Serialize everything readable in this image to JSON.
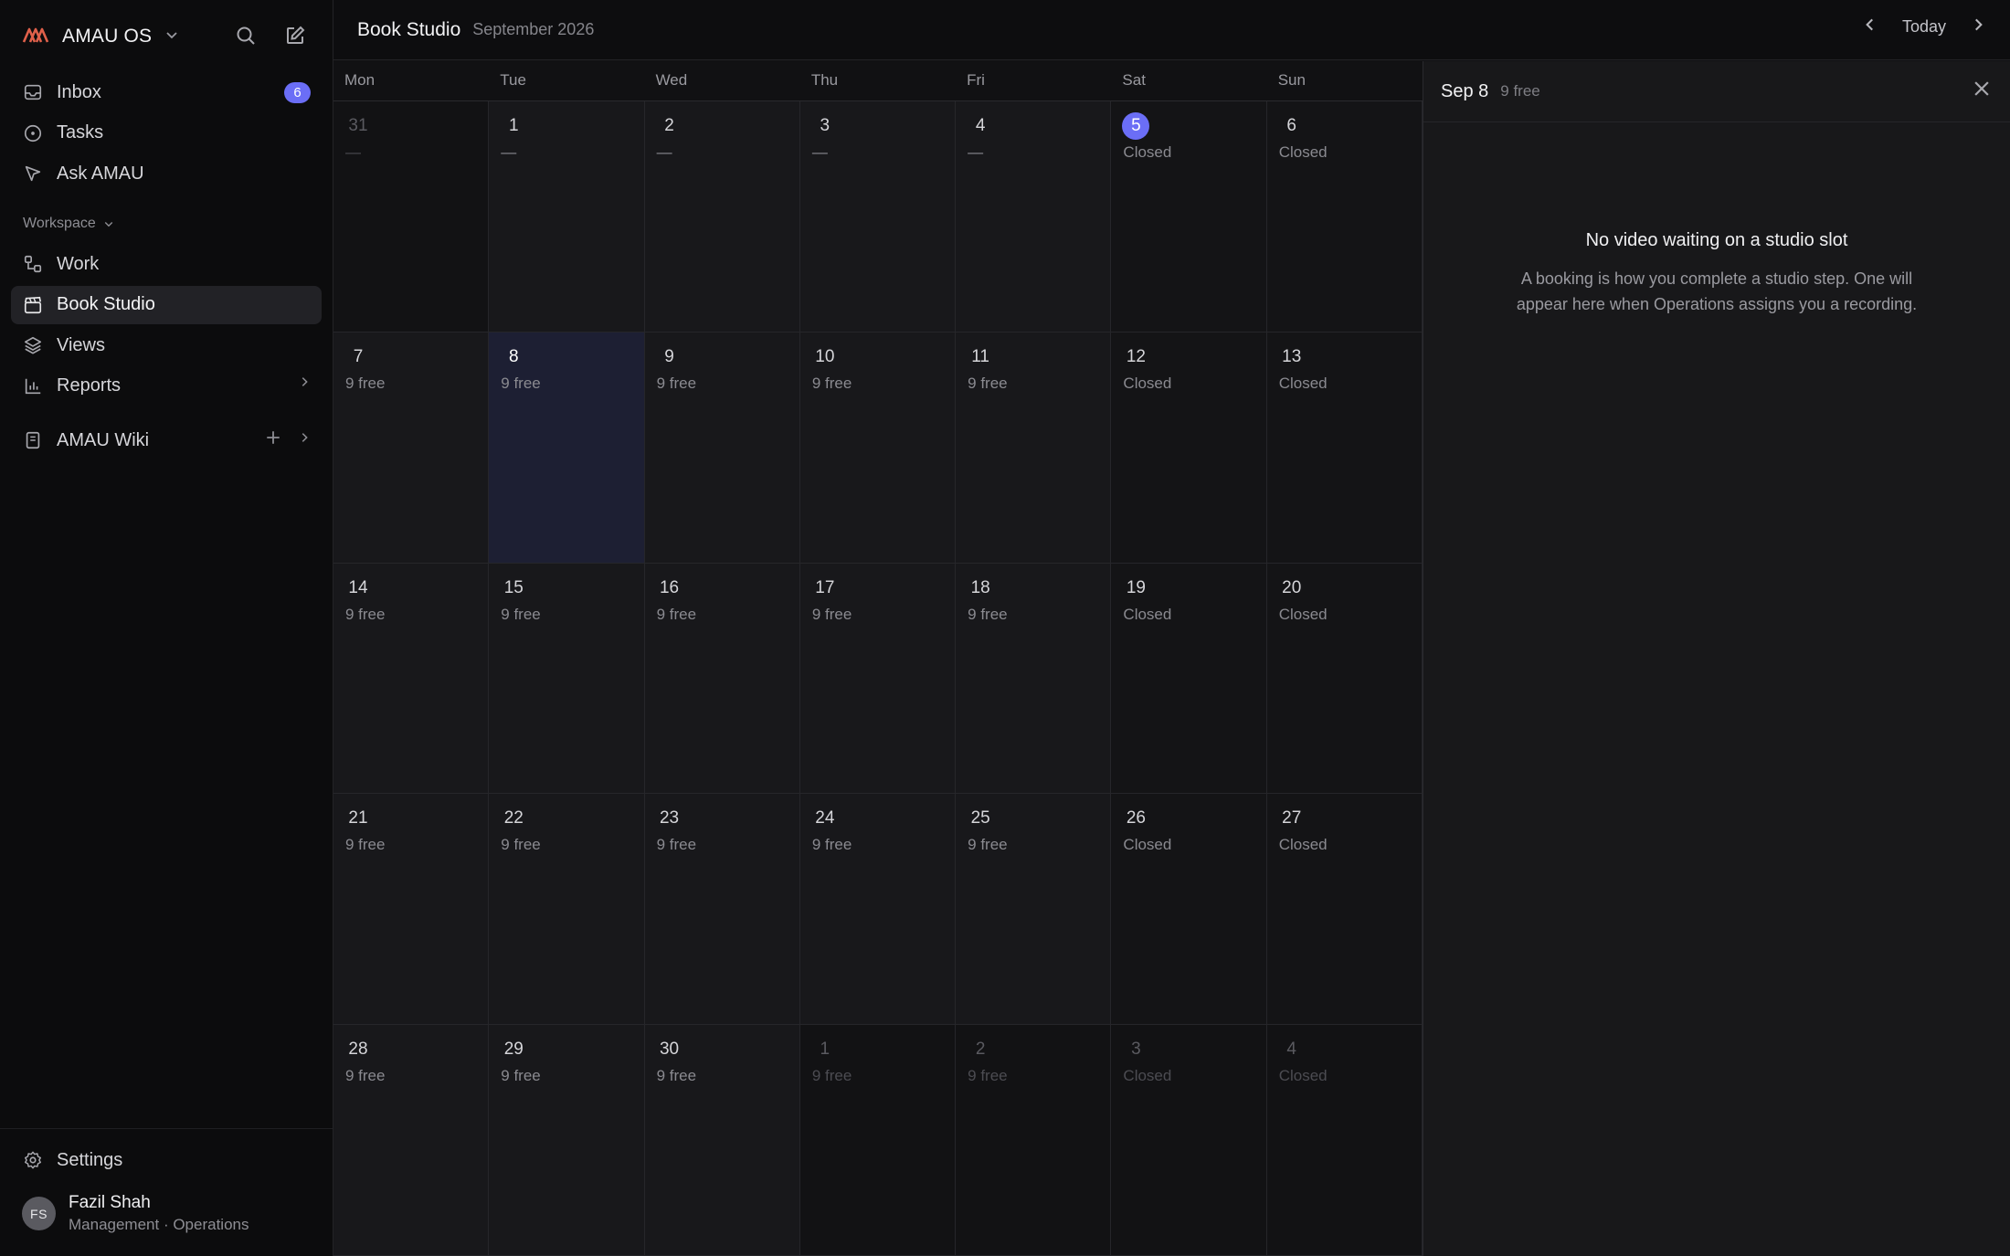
{
  "sidebar": {
    "brand": "AMAU OS",
    "primary": [
      {
        "label": "Inbox",
        "icon": "inbox-icon",
        "badge": "6"
      },
      {
        "label": "Tasks",
        "icon": "circle-dot-icon"
      },
      {
        "label": "Ask AMAU",
        "icon": "cursor-icon"
      }
    ],
    "workspace_label": "Workspace",
    "workspace": [
      {
        "label": "Work",
        "icon": "workflow-icon"
      },
      {
        "label": "Book Studio",
        "icon": "clapperboard-icon",
        "active": true
      },
      {
        "label": "Views",
        "icon": "layers-icon"
      },
      {
        "label": "Reports",
        "icon": "bar-chart-icon"
      }
    ],
    "wiki": {
      "label": "AMAU Wiki",
      "icon": "book-icon"
    },
    "settings": "Settings",
    "user": {
      "initials": "FS",
      "name": "Fazil Shah",
      "role": "Management · Operations"
    }
  },
  "header": {
    "title": "Book Studio",
    "month": "September 2026",
    "today": "Today"
  },
  "calendar": {
    "weekdays": [
      "Mon",
      "Tue",
      "Wed",
      "Thu",
      "Fri",
      "Sat",
      "Sun"
    ],
    "weeks": [
      [
        {
          "d": "31",
          "s": "—",
          "dim": true
        },
        {
          "d": "1",
          "s": "—"
        },
        {
          "d": "2",
          "s": "—"
        },
        {
          "d": "3",
          "s": "—"
        },
        {
          "d": "4",
          "s": "—"
        },
        {
          "d": "5",
          "s": "Closed",
          "today": true
        },
        {
          "d": "6",
          "s": "Closed"
        }
      ],
      [
        {
          "d": "7",
          "s": "9 free"
        },
        {
          "d": "8",
          "s": "9 free",
          "selected": true
        },
        {
          "d": "9",
          "s": "9 free"
        },
        {
          "d": "10",
          "s": "9 free"
        },
        {
          "d": "11",
          "s": "9 free"
        },
        {
          "d": "12",
          "s": "Closed"
        },
        {
          "d": "13",
          "s": "Closed"
        }
      ],
      [
        {
          "d": "14",
          "s": "9 free"
        },
        {
          "d": "15",
          "s": "9 free"
        },
        {
          "d": "16",
          "s": "9 free"
        },
        {
          "d": "17",
          "s": "9 free"
        },
        {
          "d": "18",
          "s": "9 free"
        },
        {
          "d": "19",
          "s": "Closed"
        },
        {
          "d": "20",
          "s": "Closed"
        }
      ],
      [
        {
          "d": "21",
          "s": "9 free"
        },
        {
          "d": "22",
          "s": "9 free"
        },
        {
          "d": "23",
          "s": "9 free"
        },
        {
          "d": "24",
          "s": "9 free"
        },
        {
          "d": "25",
          "s": "9 free"
        },
        {
          "d": "26",
          "s": "Closed"
        },
        {
          "d": "27",
          "s": "Closed"
        }
      ],
      [
        {
          "d": "28",
          "s": "9 free"
        },
        {
          "d": "29",
          "s": "9 free"
        },
        {
          "d": "30",
          "s": "9 free"
        },
        {
          "d": "1",
          "s": "9 free",
          "dim": true
        },
        {
          "d": "2",
          "s": "9 free",
          "dim": true
        },
        {
          "d": "3",
          "s": "Closed",
          "dim": true
        },
        {
          "d": "4",
          "s": "Closed",
          "dim": true
        }
      ]
    ]
  },
  "panel": {
    "title": "Sep 8",
    "sub": "9 free",
    "empty_title": "No video waiting on a studio slot",
    "empty_text": "A booking is how you complete a studio step. One will appear here when Operations assigns you a recording."
  },
  "colors": {
    "accent": "#6b6ef6",
    "brand": "#e0604a"
  }
}
